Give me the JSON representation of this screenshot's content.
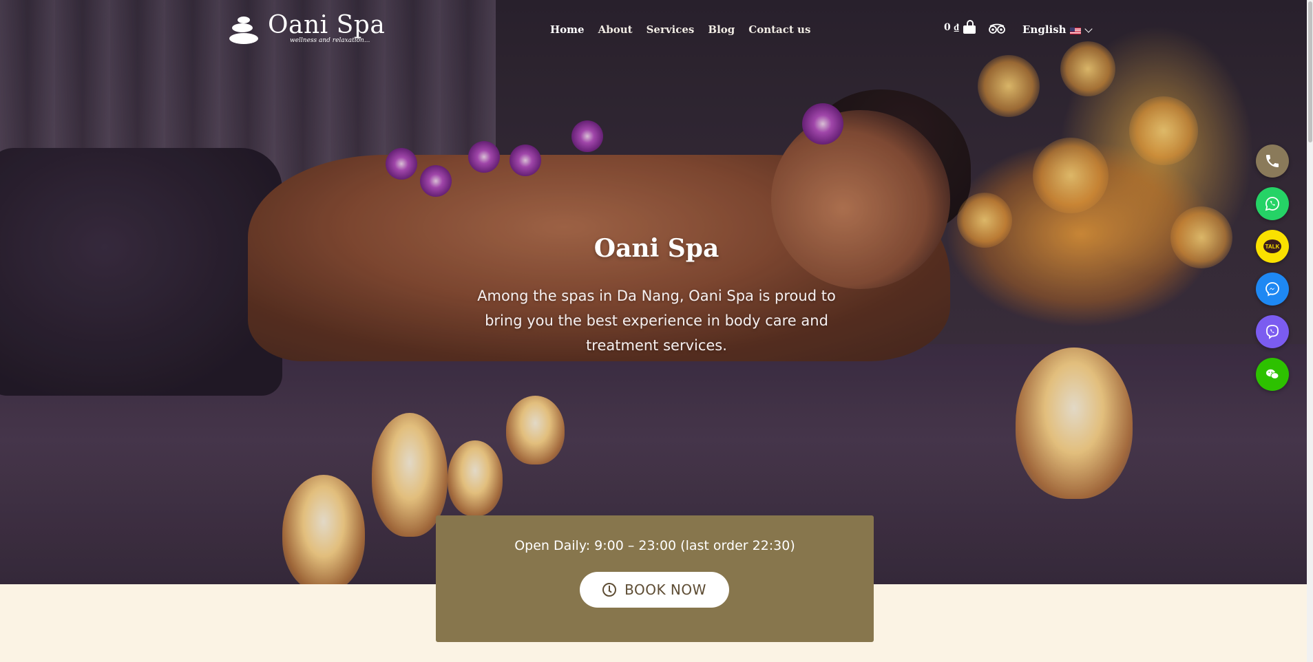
{
  "header": {
    "logo_name": "Oani Spa",
    "logo_tagline": "wellness and relaxation...",
    "nav": [
      "Home",
      "About",
      "Services",
      "Blog",
      "Contact us"
    ],
    "cart_amount": "0 ₫",
    "language": "English"
  },
  "hero": {
    "title": "Oani Spa",
    "subtitle": "Among the spas in Da Nang, Oani Spa is proud to bring you the best experience in body care and treatment services."
  },
  "booking": {
    "hours": "Open Daily: 9:00 – 23:00 (last order 22:30)",
    "button_label": "BOOK NOW"
  },
  "floating_contacts": [
    {
      "name": "phone-icon",
      "color": "#8a7a5a"
    },
    {
      "name": "whatsapp-icon",
      "color": "#25d366"
    },
    {
      "name": "kakaotalk-icon",
      "color": "#fae100",
      "label": "TALK"
    },
    {
      "name": "messenger-icon",
      "color": "#1e88f3"
    },
    {
      "name": "viber-icon",
      "color": "#7b5cf0"
    },
    {
      "name": "wechat-icon",
      "color": "#2dc100"
    }
  ],
  "colors": {
    "booking_bg": "#87764d",
    "page_bg": "#fbf3e4"
  }
}
